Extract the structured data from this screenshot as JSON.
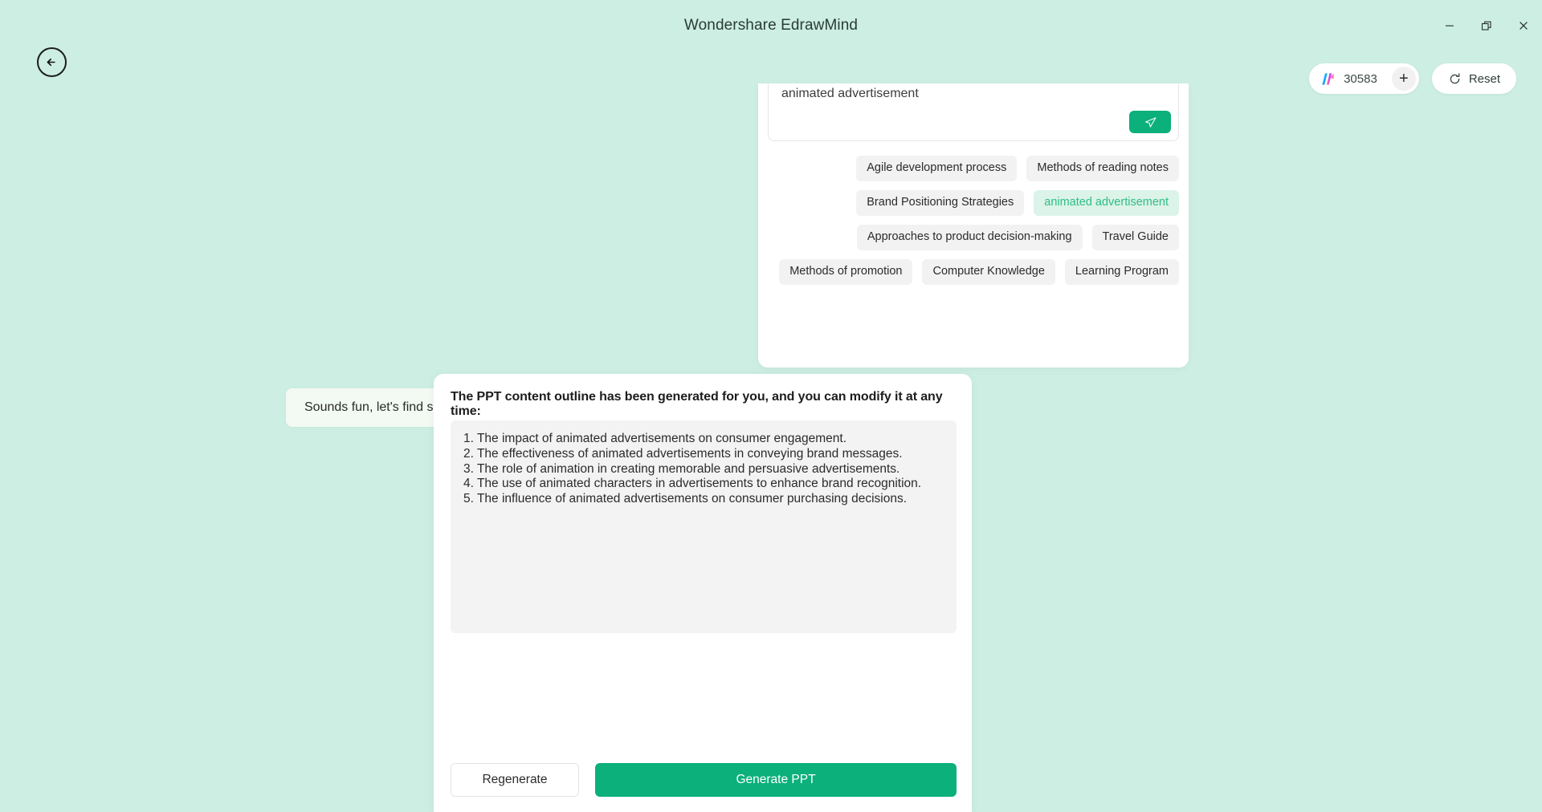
{
  "window": {
    "title": "Wondershare EdrawMind",
    "controls": [
      {
        "name": "minimize",
        "label": "Minimize"
      },
      {
        "name": "restore",
        "label": "Restore"
      },
      {
        "name": "close",
        "label": "Close"
      }
    ]
  },
  "nav": {
    "back_label": "Back",
    "back_icon": "arrow-left-icon"
  },
  "topbar": {
    "credits": {
      "icon": "wondershare-logo-icon",
      "count": "30583",
      "add_label": "+"
    },
    "reset": {
      "icon": "refresh-icon",
      "label": "Reset"
    }
  },
  "chat": {
    "input": {
      "value": "animated advertisement",
      "placeholder": "",
      "send_icon": "send-plane-icon"
    },
    "suggestion_rows": [
      [
        {
          "label": "Agile development process",
          "active": false
        },
        {
          "label": "Methods of reading notes",
          "active": false
        }
      ],
      [
        {
          "label": "Brand Positioning Strategies",
          "active": false
        },
        {
          "label": "animated advertisement",
          "active": true
        }
      ],
      [
        {
          "label": "Approaches to product decision-making",
          "active": false
        },
        {
          "label": "Travel Guide",
          "active": false
        }
      ],
      [
        {
          "label": "Methods of promotion",
          "active": false
        },
        {
          "label": "Computer Knowledge",
          "active": false
        },
        {
          "label": "Learning Program",
          "active": false
        }
      ]
    ],
    "user_message": "Sounds fun, let's find some inspiration"
  },
  "outline": {
    "heading": "The PPT content outline has been generated for you, and you can modify it at any time:",
    "items": [
      "1. The impact of animated advertisements on consumer engagement.",
      "2. The effectiveness of animated advertisements in conveying brand messages.",
      "3. The role of animation in creating memorable and persuasive advertisements.",
      "4. The use of animated characters in advertisements to enhance brand recognition.",
      "5. The influence of animated advertisements on consumer purchasing decisions."
    ],
    "regenerate_label": "Regenerate",
    "generate_label": "Generate PPT"
  },
  "colors": {
    "background": "#cdeee2",
    "accent_green": "#0bb07b",
    "chip_active_bg": "#dbf3e8",
    "chip_active_text": "#2fbd86",
    "card_white": "#ffffff",
    "outline_box": "#f3f3f3"
  }
}
